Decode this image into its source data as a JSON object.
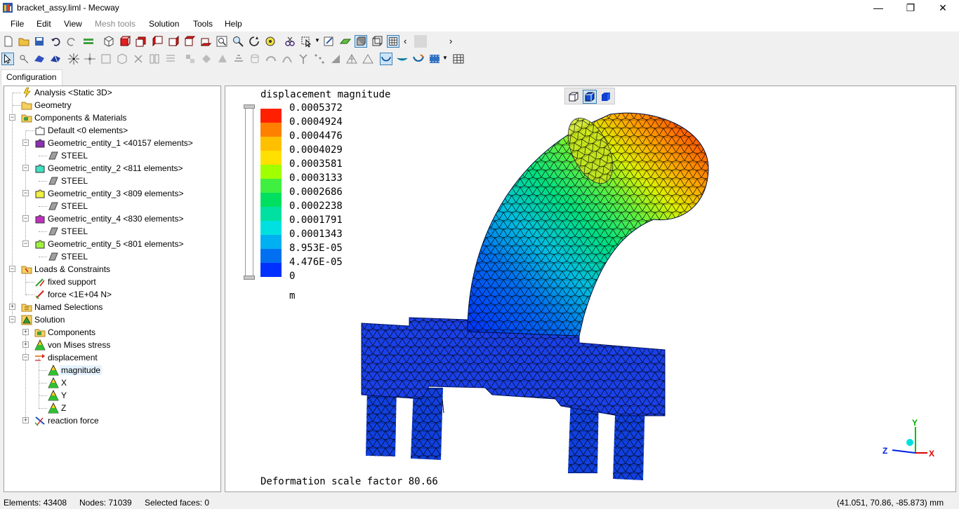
{
  "window": {
    "title": "bracket_assy.liml - Mecway",
    "minimize": "—",
    "maximize": "❐",
    "close": "✕"
  },
  "menu": [
    "File",
    "Edit",
    "View",
    "Mesh tools",
    "Solution",
    "Tools",
    "Help"
  ],
  "tabs": {
    "configuration": "Configuration"
  },
  "tree": {
    "analysis": "Analysis <Static 3D>",
    "geometry": "Geometry",
    "components": "Components & Materials",
    "default": "Default <0 elements>",
    "ge1": "Geometric_entity_1 <40157 elements>",
    "ge2": "Geometric_entity_2 <811 elements>",
    "ge3": "Geometric_entity_3 <809 elements>",
    "ge4": "Geometric_entity_4 <830 elements>",
    "ge5": "Geometric_entity_5 <801 elements>",
    "steel": "STEEL",
    "loads": "Loads & Constraints",
    "fixed": "fixed support",
    "force": "force <1E+04 N>",
    "named": "Named Selections",
    "solution": "Solution",
    "sol_components": "Components",
    "vonmises": "von Mises stress",
    "displacement": "displacement",
    "magnitude": "magnitude",
    "x": "X",
    "y": "Y",
    "z": "Z",
    "reaction": "reaction force"
  },
  "viewport": {
    "result_title": "displacement magnitude",
    "legend": {
      "colors": [
        "#ff2000",
        "#ff8000",
        "#ffc000",
        "#ffe000",
        "#a0ff00",
        "#40f040",
        "#00e060",
        "#00e0a0",
        "#00e0e0",
        "#00b0f0",
        "#0070f0",
        "#0030ff"
      ],
      "labels": [
        "0.0005372",
        "0.0004924",
        "0.0004476",
        "0.0004029",
        "0.0003581",
        "0.0003133",
        "0.0002686",
        "0.0002238",
        "0.0001791",
        "0.0001343",
        "8.953E-05",
        "4.476E-05",
        "0"
      ],
      "unit": "m"
    },
    "deformation": "Deformation scale factor 80.66",
    "axes": {
      "x": "X",
      "y": "Y",
      "z": "Z"
    }
  },
  "status": {
    "elements": "Elements: 43408",
    "nodes": "Nodes: 71039",
    "selected": "Selected faces: 0",
    "coords": "(41.051, 70.86, -85.873) mm"
  }
}
